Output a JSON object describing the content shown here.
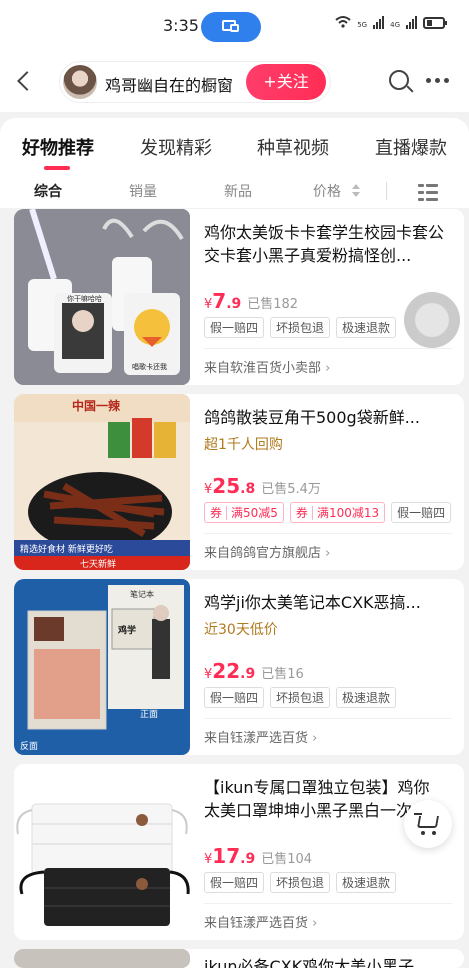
{
  "status": {
    "time": "3:35",
    "net1": "5G",
    "net2": "4G"
  },
  "header": {
    "store_name": "鸡哥幽自在的橱窗",
    "follow_label": "+关注"
  },
  "tabs": [
    {
      "label": "好物推荐"
    },
    {
      "label": "发现精彩"
    },
    {
      "label": "种草视频"
    },
    {
      "label": "直播爆款"
    }
  ],
  "sort": [
    {
      "label": "综合"
    },
    {
      "label": "销量"
    },
    {
      "label": "新品"
    },
    {
      "label": "价格"
    }
  ],
  "products": [
    {
      "title": "鸡你太美饭卡卡套学生校园卡套公交卡套小黑子真爱粉搞怪创...",
      "currency": "¥",
      "price_int": "7",
      "price_dec": ".9",
      "sold": "已售182",
      "chips": [
        "假一赔四",
        "坏损包退",
        "极速退款"
      ],
      "from": "来自软淮百货小卖部",
      "thumb_labels": [
        "你干嘛哈哈",
        "唱歌卡还我"
      ]
    },
    {
      "title": "鸽鸽散装豆角干500g袋新鲜...",
      "subtitle": "超1千人回购",
      "currency": "¥",
      "price_int": "25",
      "price_dec": ".8",
      "sold": "已售5.4万",
      "coupons": [
        {
          "tag": "券",
          "text": "满50减5"
        },
        {
          "tag": "券",
          "text": "满100减13"
        }
      ],
      "chips": [
        "假一赔四"
      ],
      "from": "来自鸽鸽官方旗舰店",
      "thumb_labels": [
        "中国一辣",
        "精选好食材 新鲜更好吃",
        "七天新鲜"
      ]
    },
    {
      "title": "鸡学ji你太美笔记本CXK恶搞...",
      "subtitle": "近30天低价",
      "currency": "¥",
      "price_int": "22",
      "price_dec": ".9",
      "sold": "已售16",
      "chips": [
        "假一赔四",
        "坏损包退",
        "极速退款"
      ],
      "from": "来自钰漾严选百货",
      "thumb_labels": [
        "笔记本",
        "鸡学",
        "正面",
        "反面"
      ]
    },
    {
      "title": "【ikun专属口罩独立包装】鸡你太美口罩坤坤小黑子黑白一次...",
      "currency": "¥",
      "price_int": "17",
      "price_dec": ".9",
      "sold": "已售104",
      "chips": [
        "假一赔四",
        "坏损包退",
        "极速退款"
      ],
      "from": "来自钰漾严选百货"
    },
    {
      "title": "ikun必备CXK鸡你太美小黑子..."
    }
  ],
  "colors": {
    "accent": "#ff2d55",
    "status_pill": "#2f80ed",
    "gold": "#b07a1e"
  },
  "icons": [
    "back-arrow-icon",
    "search-icon",
    "more-icon",
    "layout-list-icon",
    "cart-icon",
    "screen-mirror-icon",
    "wifi-icon",
    "battery-icon"
  ]
}
